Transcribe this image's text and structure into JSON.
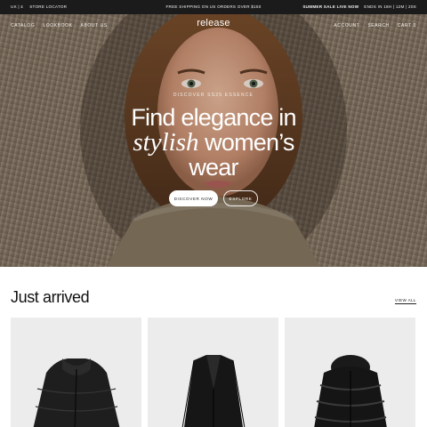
{
  "announcement": {
    "locale": "UK | £",
    "store_locator": "STORE LOCATOR",
    "shipping": "FREE SHIPPING ON US ORDERS OVER $150",
    "sale": "SUMMER SALE LIVE NOW",
    "countdown": "ENDS IN 18H | 12M | 20S"
  },
  "nav": {
    "items": [
      "CATALOG",
      "LOOKBOOK",
      "ABOUT US"
    ],
    "logo": "release",
    "account": "ACCOUNT",
    "search": "SEARCH",
    "cart": "CART",
    "cart_count": "0"
  },
  "hero": {
    "eyebrow": "DISCOVER SS25 ESSENCE",
    "headline_line1": "Find elegance in",
    "headline_italic": "stylish",
    "headline_line2_rest": " women’s",
    "headline_line3": "wear",
    "primary_button": "DISCOVER NOW",
    "secondary_button": "EXPLORE"
  },
  "just_arrived": {
    "title": "Just arrived",
    "view_all": "VIEW ALL",
    "products": [
      {
        "icon": "puffer-wrap-coat-image"
      },
      {
        "icon": "black-blazer-image"
      },
      {
        "icon": "hooded-puffer-jacket-image"
      }
    ]
  },
  "colors": {
    "topbar_bg": "#1b1b1b",
    "card_bg": "#ececec",
    "text": "#111111"
  }
}
